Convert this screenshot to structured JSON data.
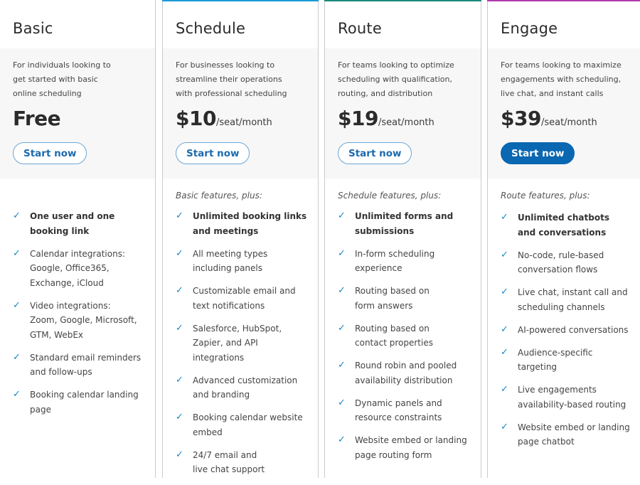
{
  "plans": [
    {
      "name": "Basic",
      "accent": null,
      "description": "For individuals looking to\nget started with basic\nonline scheduling",
      "price": "Free",
      "price_unit": "",
      "button_label": "Start now",
      "button_style": "outline",
      "features_intro": "",
      "features": [
        {
          "text": "One user and one booking link",
          "bold": true
        },
        {
          "text": "Calendar integrations: Google, Office365, Exchange, iCloud",
          "bold": false
        },
        {
          "text": "Video integrations: Zoom, Google, Microsoft, GTM, WebEx",
          "bold": false
        },
        {
          "text": "Standard email reminders and follow-ups",
          "bold": false
        },
        {
          "text": "Booking calendar landing page",
          "bold": false
        }
      ]
    },
    {
      "name": "Schedule",
      "accent": "#1a9ad6",
      "description": "For businesses looking to\nstreamline their operations\nwith professional scheduling",
      "price": "$10",
      "price_unit": "/seat/month",
      "button_label": "Start now",
      "button_style": "outline",
      "features_intro": "Basic features, plus:",
      "features": [
        {
          "text": "Unlimited booking links and meetings",
          "bold": true
        },
        {
          "text": "All meeting types including panels",
          "bold": false
        },
        {
          "text": "Customizable email and text notifications",
          "bold": false
        },
        {
          "text": "Salesforce, HubSpot, Zapier, and API integrations",
          "bold": false
        },
        {
          "text": "Advanced customization and branding",
          "bold": false
        },
        {
          "text": "Booking calendar website embed",
          "bold": false
        },
        {
          "text": "24/7 email and live chat support",
          "bold": false
        }
      ]
    },
    {
      "name": "Route",
      "accent": "#1a8a7c",
      "description": "For teams looking to optimize\nscheduling with qualification,\nrouting, and distribution",
      "price": "$19",
      "price_unit": "/seat/month",
      "button_label": "Start now",
      "button_style": "outline",
      "features_intro": "Schedule features, plus:",
      "features": [
        {
          "text": "Unlimited forms and submissions",
          "bold": true
        },
        {
          "text": "In-form scheduling experience",
          "bold": false
        },
        {
          "text": "Routing based on form answers",
          "bold": false
        },
        {
          "text": "Routing based on contact properties",
          "bold": false
        },
        {
          "text": "Round robin and pooled availability distribution",
          "bold": false
        },
        {
          "text": "Dynamic panels and resource constraints",
          "bold": false
        },
        {
          "text": "Website embed or landing page routing form",
          "bold": false
        }
      ]
    },
    {
      "name": "Engage",
      "accent": "#b23ab0",
      "description": "For teams looking to maximize\nengagements with scheduling,\nlive chat, and instant calls",
      "price": "$39",
      "price_unit": "/seat/month",
      "button_label": "Start now",
      "button_style": "primary",
      "features_intro": "Route features, plus:",
      "features": [
        {
          "text": "Unlimited chatbots and conversations",
          "bold": true
        },
        {
          "text": "No-code, rule-based conversation flows",
          "bold": false
        },
        {
          "text": "Live chat, instant call and scheduling channels",
          "bold": false
        },
        {
          "text": "AI-powered conversations",
          "bold": false
        },
        {
          "text": "Audience-specific targeting",
          "bold": false
        },
        {
          "text": "Live engagements availability-based routing",
          "bold": false
        },
        {
          "text": "Website embed or landing page chatbot",
          "bold": false
        }
      ]
    }
  ],
  "icons": {
    "check": "✓"
  }
}
